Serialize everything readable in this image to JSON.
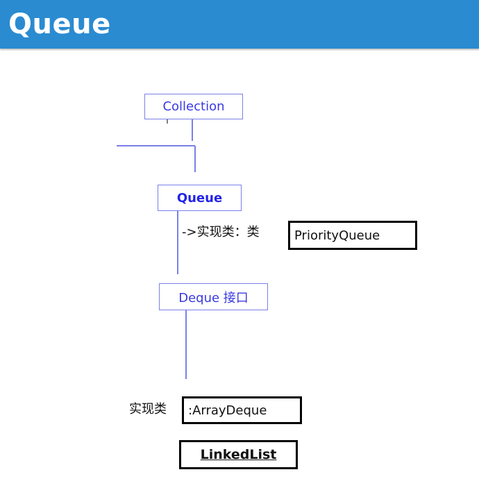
{
  "header": {
    "title": "Queue"
  },
  "diagram": {
    "nodes": {
      "collection": "Collection",
      "queue": "Queue",
      "deque": "Deque 接口"
    },
    "queue_impl": {
      "prefix": "->实现类：类",
      "class_name": "PriorityQueue"
    },
    "deque_impl": {
      "prefix": "实现类",
      "class_name": ":ArrayDeque",
      "second_class": "LinkedList"
    },
    "colors": {
      "header": "#2a8bd1",
      "node_border": "#7b7fe8",
      "node_text": "#3a3ae0",
      "connector": "#7b7fe8"
    }
  }
}
